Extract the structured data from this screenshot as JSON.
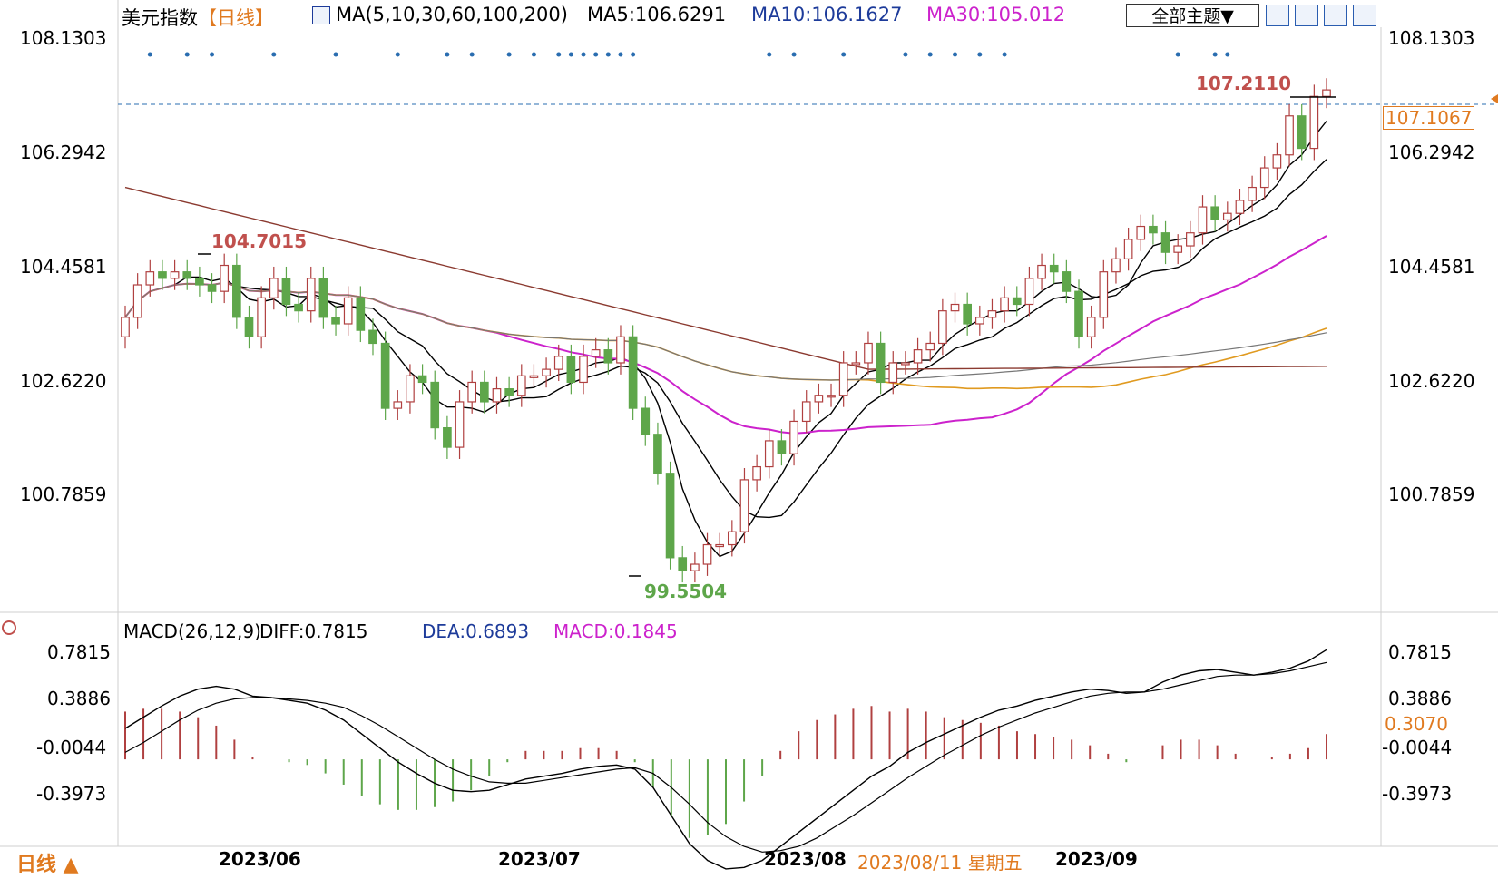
{
  "header": {
    "title": "美元指数",
    "period": "【日线】",
    "ma_label": "MA(5,10,30,60,100,200)",
    "ma5": "MA5:106.6291",
    "ma10": "MA10:106.1627",
    "ma30": "MA30:105.012",
    "theme_button": "全部主题▼"
  },
  "price_axis": {
    "left_ticks": [
      "108.1303",
      "106.2942",
      "104.4581",
      "102.6220",
      "100.7859"
    ],
    "right_ticks": [
      "108.1303",
      "106.2942",
      "104.4581",
      "102.6220",
      "100.7859"
    ],
    "current_price": "107.1067",
    "high_annotation": "107.2110",
    "peak_annotation": "104.7015",
    "low_annotation": "99.5504"
  },
  "macd": {
    "label": "MACD(26,12,9)",
    "diff": "DIFF:0.7815",
    "dea": "DEA:0.6893",
    "macd": "MACD:0.1845",
    "left_ticks": [
      "0.7815",
      "0.3886",
      "-0.0044",
      "-0.3973"
    ],
    "right_ticks": [
      "0.7815",
      "0.3886",
      "-0.0044",
      "-0.3973"
    ],
    "right_current": "0.3070"
  },
  "x_axis": {
    "labels": [
      "2023/06",
      "2023/07",
      "2023/08",
      "2023/09"
    ],
    "cursor_date": "2023/08/11 星期五",
    "period_selector": "日线 ▲"
  },
  "colors": {
    "up": "#b04040",
    "down": "#5ea64a",
    "ma5": "#000000",
    "ma10": "#000000",
    "ma30": "#cc22cc",
    "ma60": "#e09a20",
    "ma100": "#777777",
    "ma200": "#8b3a30",
    "diff": "#000000",
    "dea": "#000000",
    "accent": "#e07a20",
    "blue_label": "#1d3b9a"
  },
  "chart_data": {
    "type": "candlestick",
    "title": "美元指数",
    "period": "日线",
    "ylim": [
      99.2,
      108.4
    ],
    "y_ticks": [
      108.1303,
      106.2942,
      104.4581,
      102.622,
      100.7859
    ],
    "close": [
      103.6,
      104.1,
      104.3,
      104.2,
      104.3,
      104.2,
      104.1,
      104.0,
      104.4,
      103.6,
      103.3,
      103.9,
      104.2,
      103.8,
      103.7,
      104.2,
      103.6,
      103.5,
      103.9,
      103.4,
      103.2,
      102.2,
      102.3,
      102.7,
      102.6,
      101.9,
      101.6,
      102.3,
      102.6,
      102.3,
      102.5,
      102.4,
      102.7,
      102.7,
      102.8,
      103.0,
      102.6,
      103.0,
      103.1,
      102.9,
      103.3,
      102.2,
      101.8,
      101.2,
      99.9,
      99.7,
      99.8,
      100.1,
      100.1,
      100.3,
      101.1,
      101.3,
      101.7,
      101.5,
      102.0,
      102.3,
      102.4,
      102.4,
      102.9,
      102.9,
      103.2,
      102.6,
      102.9,
      102.9,
      103.1,
      103.2,
      103.7,
      103.8,
      103.5,
      103.6,
      103.7,
      103.9,
      103.8,
      104.2,
      104.4,
      104.3,
      104.0,
      103.3,
      103.6,
      104.3,
      104.5,
      104.8,
      105.0,
      104.9,
      104.6,
      104.7,
      104.9,
      105.3,
      105.1,
      105.2,
      105.4,
      105.6,
      105.9,
      106.1,
      106.7,
      106.2,
      107.0,
      107.1
    ],
    "open": [
      103.3,
      103.6,
      104.1,
      104.3,
      104.2,
      104.3,
      104.2,
      104.1,
      104.0,
      104.4,
      103.6,
      103.3,
      103.9,
      104.2,
      103.8,
      103.7,
      104.2,
      103.6,
      103.5,
      103.9,
      103.4,
      103.2,
      102.2,
      102.3,
      102.7,
      102.6,
      101.9,
      101.6,
      102.3,
      102.6,
      102.3,
      102.5,
      102.4,
      102.7,
      102.7,
      102.8,
      103.0,
      102.6,
      103.0,
      103.1,
      102.9,
      103.3,
      102.2,
      101.8,
      101.2,
      99.9,
      99.7,
      99.8,
      100.1,
      100.1,
      100.3,
      101.1,
      101.3,
      101.7,
      101.5,
      102.0,
      102.3,
      102.4,
      102.4,
      102.9,
      102.9,
      103.2,
      102.6,
      102.9,
      102.9,
      103.1,
      103.2,
      103.7,
      103.8,
      103.5,
      103.6,
      103.7,
      103.9,
      103.8,
      104.2,
      104.4,
      104.3,
      104.0,
      103.3,
      103.6,
      104.3,
      104.5,
      104.8,
      105.0,
      104.9,
      104.6,
      104.7,
      104.9,
      105.3,
      105.1,
      105.2,
      105.4,
      105.6,
      105.9,
      106.1,
      106.7,
      106.2,
      107.0
    ],
    "high_point": 107.211,
    "low_point": 99.5504,
    "local_peak": 104.7015,
    "last_price": 107.1067,
    "series": [
      {
        "name": "MA5",
        "value": 106.6291
      },
      {
        "name": "MA10",
        "value": 106.1627
      },
      {
        "name": "MA30",
        "value": 105.012
      }
    ],
    "macd": {
      "ylim": [
        -0.6,
        0.95
      ],
      "y_ticks": [
        0.7815,
        0.3886,
        -0.0044,
        -0.3973
      ],
      "diff": [
        0.22,
        0.3,
        0.38,
        0.45,
        0.5,
        0.52,
        0.5,
        0.45,
        0.44,
        0.42,
        0.4,
        0.35,
        0.28,
        0.18,
        0.08,
        -0.02,
        -0.1,
        -0.17,
        -0.22,
        -0.23,
        -0.22,
        -0.18,
        -0.14,
        -0.12,
        -0.1,
        -0.07,
        -0.05,
        -0.04,
        -0.07,
        -0.2,
        -0.4,
        -0.6,
        -0.72,
        -0.78,
        -0.77,
        -0.72,
        -0.62,
        -0.52,
        -0.42,
        -0.32,
        -0.22,
        -0.12,
        -0.05,
        0.05,
        0.12,
        0.18,
        0.24,
        0.3,
        0.35,
        0.38,
        0.42,
        0.45,
        0.48,
        0.5,
        0.49,
        0.47,
        0.48,
        0.55,
        0.6,
        0.63,
        0.64,
        0.62,
        0.6,
        0.62,
        0.65,
        0.7,
        0.78
      ],
      "dea": [
        0.05,
        0.12,
        0.2,
        0.28,
        0.35,
        0.4,
        0.43,
        0.44,
        0.44,
        0.43,
        0.42,
        0.4,
        0.37,
        0.31,
        0.24,
        0.16,
        0.08,
        0.0,
        -0.07,
        -0.12,
        -0.16,
        -0.17,
        -0.17,
        -0.15,
        -0.13,
        -0.11,
        -0.09,
        -0.07,
        -0.06,
        -0.1,
        -0.2,
        -0.32,
        -0.45,
        -0.55,
        -0.62,
        -0.66,
        -0.65,
        -0.62,
        -0.56,
        -0.48,
        -0.4,
        -0.31,
        -0.22,
        -0.13,
        -0.05,
        0.03,
        0.1,
        0.17,
        0.23,
        0.28,
        0.33,
        0.37,
        0.41,
        0.45,
        0.47,
        0.48,
        0.48,
        0.5,
        0.53,
        0.56,
        0.59,
        0.6,
        0.6,
        0.61,
        0.63,
        0.66,
        0.69
      ],
      "hist": [
        0.34,
        0.36,
        0.36,
        0.34,
        0.3,
        0.24,
        0.14,
        0.02,
        0.0,
        -0.02,
        -0.04,
        -0.1,
        -0.18,
        -0.26,
        -0.32,
        -0.36,
        -0.36,
        -0.34,
        -0.3,
        -0.22,
        -0.12,
        -0.02,
        0.06,
        0.06,
        0.06,
        0.08,
        0.08,
        0.06,
        -0.02,
        -0.2,
        -0.4,
        -0.56,
        -0.54,
        -0.46,
        -0.3,
        -0.12,
        0.06,
        0.2,
        0.28,
        0.32,
        0.36,
        0.38,
        0.34,
        0.36,
        0.34,
        0.3,
        0.28,
        0.26,
        0.24,
        0.2,
        0.18,
        0.16,
        0.14,
        0.1,
        0.04,
        -0.02,
        0.0,
        0.1,
        0.14,
        0.14,
        0.1,
        0.04,
        0.0,
        0.02,
        0.04,
        0.08,
        0.18
      ]
    },
    "x_labels": [
      "2023/06",
      "2023/07",
      "2023/08",
      "2023/09"
    ]
  }
}
